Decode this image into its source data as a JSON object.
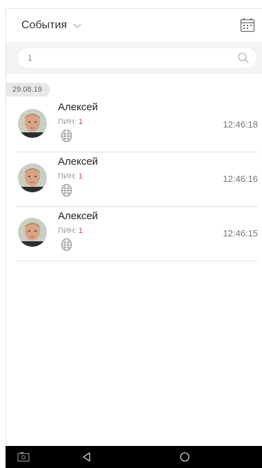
{
  "header": {
    "title": "События"
  },
  "search": {
    "value": "1"
  },
  "events": {
    "date": "29.08.19",
    "pin_label": "ПИН:",
    "items": [
      {
        "name": "Алексей",
        "pin": "1",
        "time": "12:46:18"
      },
      {
        "name": "Алексей",
        "pin": "1",
        "time": "12:46:16"
      },
      {
        "name": "Алексей",
        "pin": "1",
        "time": "12:46:15"
      }
    ]
  },
  "icons": {
    "dropdown": "chevron-down-icon",
    "calendar": "calendar-icon",
    "search": "search-icon",
    "face": "face-scan-icon",
    "nav_screenshot": "screenshot-icon",
    "nav_back": "back-triangle-icon",
    "nav_home": "home-circle-icon"
  },
  "colors": {
    "pin_value": "#e53935",
    "search_band": "#f3f3f3",
    "navbar": "#000000"
  }
}
